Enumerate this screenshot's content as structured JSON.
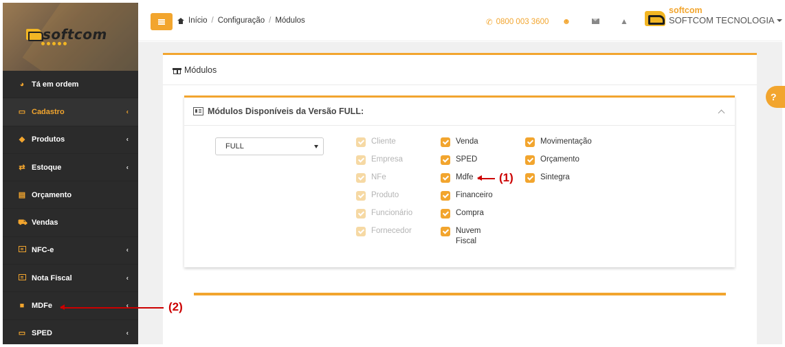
{
  "sidebar": {
    "logo_text": "softcom",
    "items": [
      {
        "label": "Tá em ordem",
        "icon": "pie-chart-icon",
        "has_chevron": false,
        "active": false
      },
      {
        "label": "Cadastro",
        "icon": "folder-open-icon",
        "has_chevron": true,
        "active": true
      },
      {
        "label": "Produtos",
        "icon": "tag-icon",
        "has_chevron": true,
        "active": false
      },
      {
        "label": "Estoque",
        "icon": "exchange-icon",
        "has_chevron": true,
        "active": false
      },
      {
        "label": "Orçamento",
        "icon": "document-icon",
        "has_chevron": false,
        "active": false
      },
      {
        "label": "Vendas",
        "icon": "cart-icon",
        "has_chevron": false,
        "active": false
      },
      {
        "label": "NFC-e",
        "icon": "newspaper-icon",
        "has_chevron": true,
        "active": false
      },
      {
        "label": "Nota Fiscal",
        "icon": "newspaper-icon",
        "has_chevron": true,
        "active": false
      },
      {
        "label": "MDFe",
        "icon": "truck-icon",
        "has_chevron": true,
        "active": false
      },
      {
        "label": "SPED",
        "icon": "folder-open-icon",
        "has_chevron": true,
        "active": false
      }
    ]
  },
  "header": {
    "breadcrumb": [
      "Início",
      "Configuração",
      "Módulos"
    ],
    "phone": "0800 003 3600",
    "user_brand": "softcom",
    "user_company": "SOFTCOM TECNOLOGIA"
  },
  "page": {
    "title": "Módulos",
    "section_title": "Módulos Disponíveis da Versão FULL:",
    "version_select": "FULL"
  },
  "modules": {
    "col1": [
      {
        "label": "Cliente",
        "enabled": false
      },
      {
        "label": "Empresa",
        "enabled": false
      },
      {
        "label": "NFe",
        "enabled": false
      },
      {
        "label": "Produto",
        "enabled": false
      },
      {
        "label": "Funcionário",
        "enabled": false
      },
      {
        "label": "Fornecedor",
        "enabled": false
      }
    ],
    "col2": [
      {
        "label": "Venda",
        "enabled": true
      },
      {
        "label": "SPED",
        "enabled": true
      },
      {
        "label": "Mdfe",
        "enabled": true
      },
      {
        "label": "Financeiro",
        "enabled": true
      },
      {
        "label": "Compra",
        "enabled": true
      },
      {
        "label": "Nuvem Fiscal",
        "enabled": true
      }
    ],
    "col3": [
      {
        "label": "Movimentação",
        "enabled": true
      },
      {
        "label": "Orçamento",
        "enabled": true
      },
      {
        "label": "Sintegra",
        "enabled": true
      }
    ]
  },
  "annotations": {
    "label1": "(1)",
    "label2": "(2)"
  },
  "help": {
    "label": "?"
  },
  "colors": {
    "accent": "#f2a52e",
    "sidebar_bg": "#2b2b2b",
    "annotation": "#cc0000"
  }
}
